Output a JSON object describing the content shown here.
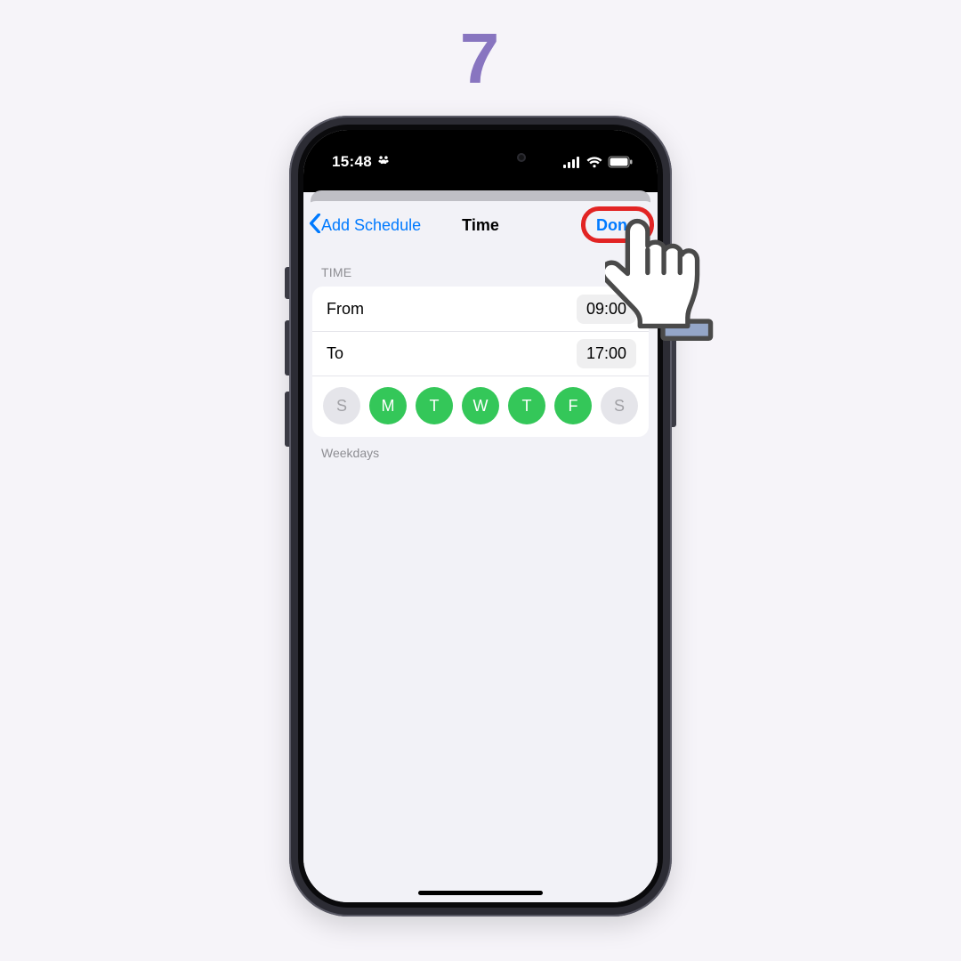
{
  "step": "7",
  "status": {
    "time": "15:48",
    "pawn_glyph": "✽"
  },
  "nav": {
    "back_label": "Add Schedule",
    "title": "Time",
    "done_label": "Done"
  },
  "schedule": {
    "section_header": "TIME",
    "rows": {
      "from": {
        "label": "From",
        "value": "09:00"
      },
      "to": {
        "label": "To",
        "value": "17:00"
      }
    },
    "days": [
      {
        "initial": "S",
        "selected": false
      },
      {
        "initial": "M",
        "selected": true
      },
      {
        "initial": "T",
        "selected": true
      },
      {
        "initial": "W",
        "selected": true
      },
      {
        "initial": "T",
        "selected": true
      },
      {
        "initial": "F",
        "selected": true
      },
      {
        "initial": "S",
        "selected": false
      }
    ],
    "footer": "Weekdays"
  },
  "colors": {
    "accent_blue": "#007aff",
    "accent_green": "#34c759",
    "highlight_red": "#e22424",
    "step_purple": "#8875c0"
  }
}
